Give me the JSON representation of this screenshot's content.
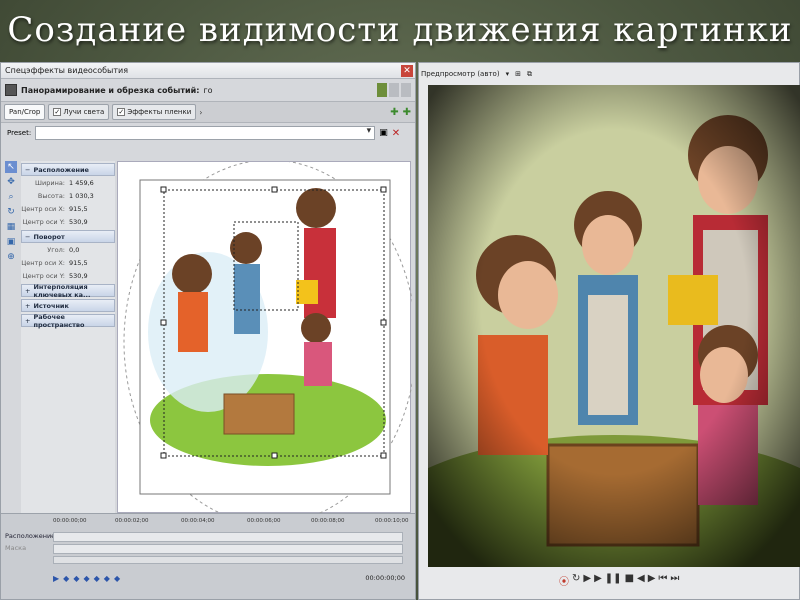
{
  "slide": {
    "title": "Создание видимости движения картинки"
  },
  "left_window": {
    "title": "Спецэффекты видеособытия",
    "pan_label": "Панорамирование и обрезка событий:",
    "pan_value": "го",
    "tabs": [
      {
        "label": "Pan/Crop"
      },
      {
        "label": "Лучи света"
      },
      {
        "label": "Эффекты пленки"
      }
    ],
    "preset_label": "Preset:",
    "preset_value": "",
    "sections": {
      "position": {
        "label": "Расположение",
        "toggle": "−"
      },
      "rotation": {
        "label": "Поворот",
        "toggle": "−"
      },
      "interp": {
        "label": "Интерполяция ключевых ка...",
        "toggle": "+"
      },
      "source": {
        "label": "Источник",
        "toggle": "+"
      },
      "workspace": {
        "label": "Рабочее пространство",
        "toggle": "+"
      }
    },
    "position_props": [
      {
        "key": "Ширина:",
        "value": "1 459,6"
      },
      {
        "key": "Высота:",
        "value": "1 030,3"
      },
      {
        "key": "Центр оси X:",
        "value": "915,5"
      },
      {
        "key": "Центр оси Y:",
        "value": "530,9"
      }
    ],
    "rotation_props": [
      {
        "key": "Угол:",
        "value": "0,0"
      },
      {
        "key": "Центр оси X:",
        "value": "915,5"
      },
      {
        "key": "Центр оси Y:",
        "value": "530,9"
      }
    ],
    "timeline": {
      "ticks": [
        "00:00:00;00",
        "00:00:02;00",
        "00:00:04;00",
        "00:00:06;00",
        "00:00:08;00",
        "00:00:10;00"
      ],
      "track1": "Расположение",
      "track2": "Маска",
      "timecode": "00:00:00;00"
    }
  },
  "right_window": {
    "toolbar_label": "Предпросмотр (авто)"
  },
  "colors": {
    "accent": "#6b8ed0",
    "close": "#c8453b",
    "record": "#c0392b"
  }
}
